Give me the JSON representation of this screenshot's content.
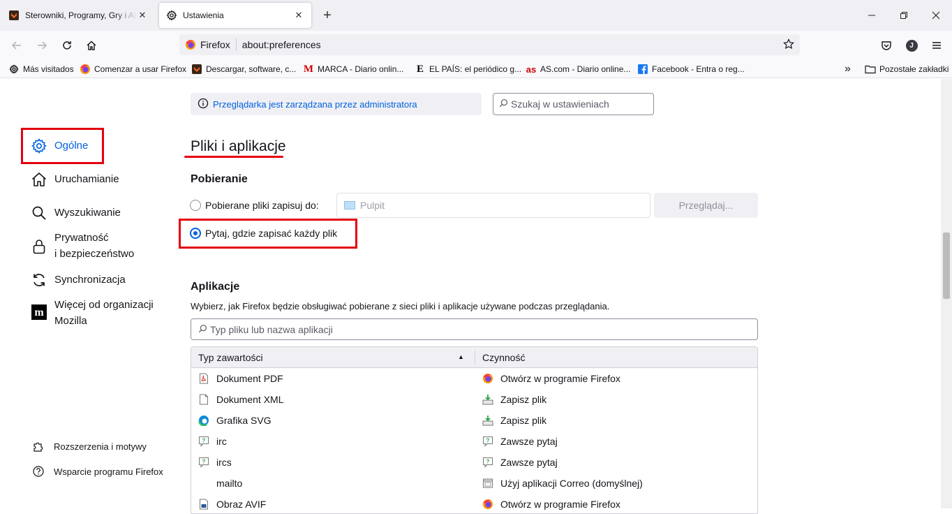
{
  "tabs": [
    {
      "title": "Sterowniki, Programy, Gry i Aktualności",
      "icon": "softonic-icon",
      "active": false
    },
    {
      "title": "Ustawienia",
      "icon": "gear-icon",
      "active": true
    }
  ],
  "urlbar": {
    "identity_label": "Firefox",
    "url": "about:preferences"
  },
  "bookmarks": [
    {
      "label": "Más visitados",
      "icon": "gear-icon"
    },
    {
      "label": "Comenzar a usar Firefox",
      "icon": "firefox-icon"
    },
    {
      "label": "Descargar, software, c...",
      "icon": "softonic-icon"
    },
    {
      "label": "MARCA - Diario onlin...",
      "icon": "marca-icon"
    },
    {
      "label": "EL PAÍS: el periódico g...",
      "icon": "elpais-icon"
    },
    {
      "label": "AS.com - Diario online...",
      "icon": "as-icon"
    },
    {
      "label": "Facebook - Entra o reg...",
      "icon": "facebook-icon"
    }
  ],
  "bookmarks_other": "Pozostałe zakładki",
  "policy_notice": "Przeglądarka jest zarządzana przez administratora",
  "search_placeholder": "Szukaj w ustawieniach",
  "sidebar": {
    "items": [
      {
        "label": "Ogólne",
        "icon": "gear-icon",
        "selected": true
      },
      {
        "label": "Uruchamianie",
        "icon": "home-icon"
      },
      {
        "label": "Wyszukiwanie",
        "icon": "search-icon"
      },
      {
        "label": "Prywatność",
        "label2": "i bezpieczeństwo",
        "icon": "lock-icon"
      },
      {
        "label": "Synchronizacja",
        "icon": "sync-icon"
      },
      {
        "label": "Więcej od organizacji",
        "label2": "Mozilla",
        "icon": "mozilla-icon"
      }
    ],
    "footer": [
      {
        "label": "Rozszerzenia i motywy",
        "icon": "puzzle-icon"
      },
      {
        "label": "Wsparcie programu Firefox",
        "icon": "help-icon"
      }
    ]
  },
  "section_title": "Pliki i aplikacje",
  "downloads": {
    "heading": "Pobieranie",
    "option_save_to": "Pobierane pliki zapisuj do:",
    "folder": "Pulpit",
    "browse": "Przeglądaj...",
    "option_ask": "Pytaj, gdzie zapisać każdy plik",
    "selected": "ask"
  },
  "applications": {
    "heading": "Aplikacje",
    "description": "Wybierz, jak Firefox będzie obsługiwać pobierane z sieci pliki i aplikacje używane podczas przeglądania.",
    "filter_placeholder": "Typ pliku lub nazwa aplikacji",
    "columns": [
      "Typ zawartości",
      "Czynność"
    ],
    "sort_indicator": "▲",
    "rows": [
      {
        "type": "Dokument PDF",
        "type_icon": "pdf-icon",
        "action": "Otwórz w programie Firefox",
        "action_icon": "firefox-icon"
      },
      {
        "type": "Dokument XML",
        "type_icon": "file-icon",
        "action": "Zapisz plik",
        "action_icon": "save-file-icon"
      },
      {
        "type": "Grafika SVG",
        "type_icon": "edge-icon",
        "action": "Zapisz plik",
        "action_icon": "save-file-icon"
      },
      {
        "type": "irc",
        "type_icon": "chat-icon",
        "action": "Zawsze pytaj",
        "action_icon": "ask-icon"
      },
      {
        "type": "ircs",
        "type_icon": "chat-icon",
        "action": "Zawsze pytaj",
        "action_icon": "ask-icon"
      },
      {
        "type": "mailto",
        "type_icon": "",
        "action": "Użyj aplikacji Correo (domyślnej)",
        "action_icon": "app-window-icon"
      },
      {
        "type": "Obraz AVIF",
        "type_icon": "image-file-icon",
        "action": "Otwórz w programie Firefox",
        "action_icon": "firefox-icon"
      }
    ]
  },
  "accent_colors": {
    "link": "#0061e0",
    "highlight": "#e4000f"
  }
}
